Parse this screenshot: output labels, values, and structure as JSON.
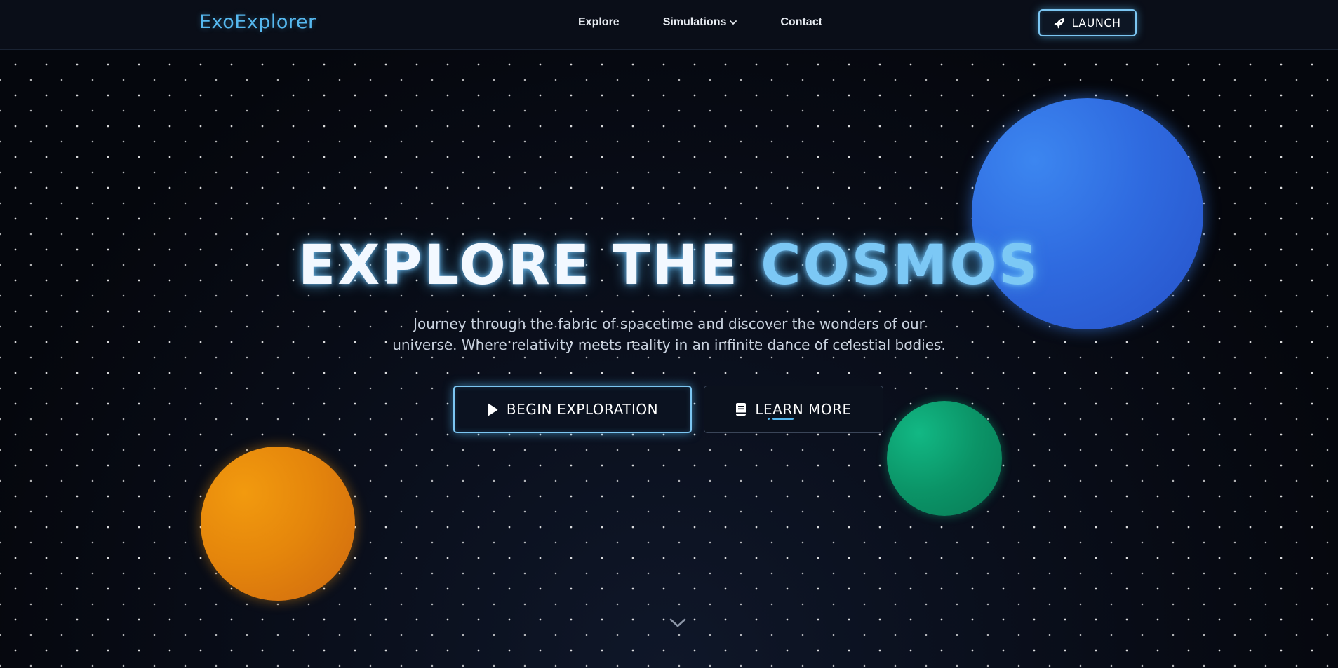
{
  "header": {
    "logo": "ExoExplorer",
    "nav": [
      {
        "label": "Explore"
      },
      {
        "label": "Simulations",
        "has_dropdown": true
      },
      {
        "label": "Contact"
      }
    ],
    "launch_label": "LAUNCH"
  },
  "hero": {
    "title_part1": "EXPLORE THE ",
    "title_part2": "COSMOS",
    "subtitle_line1": "Journey through the fabric of spacetime and discover the wonders of our",
    "subtitle_line2": "universe. Where relativity meets reality in an infinite dance of celestial bodies.",
    "primary_button": "BEGIN EXPLORATION",
    "secondary_button": "LEARN MORE"
  },
  "colors": {
    "accent": "#56b8ef",
    "planet_blue": "#2f6be0",
    "planet_green": "#0b9467",
    "planet_orange": "#e5860c",
    "background": "#05070d"
  },
  "icons": {
    "launch": "rocket-icon",
    "primary": "play-icon",
    "secondary": "book-icon",
    "scroll": "chevron-down-icon"
  }
}
